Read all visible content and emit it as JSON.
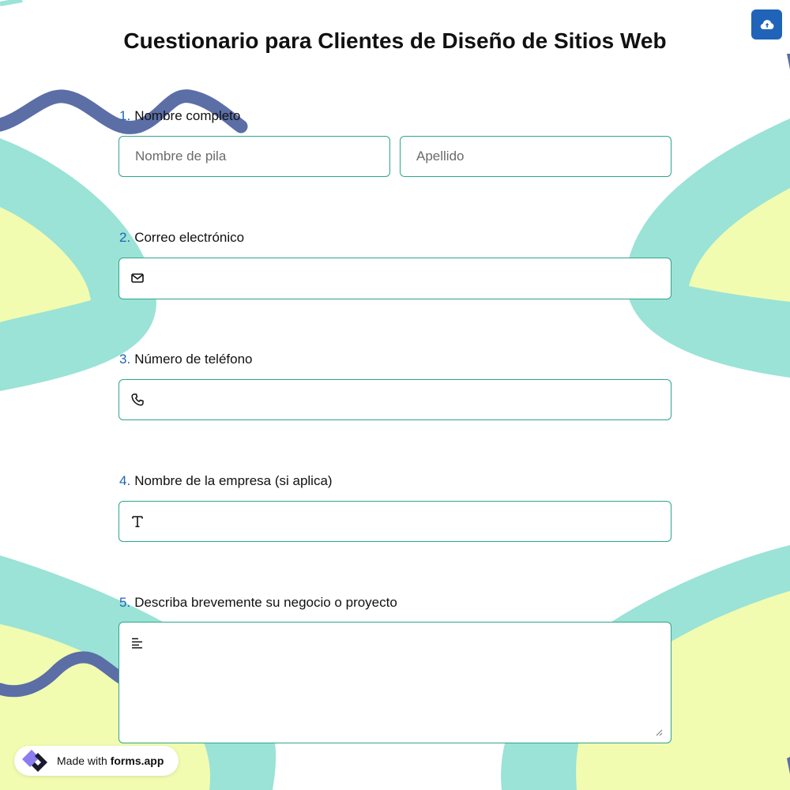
{
  "form": {
    "title": "Cuestionario para Clientes de Diseño de Sitios Web"
  },
  "toolbar": {
    "save_icon": "cloud-upload-icon"
  },
  "questions": [
    {
      "number": "1.",
      "label": "Nombre completo",
      "first_name_placeholder": "Nombre de pila",
      "last_name_placeholder": "Apellido"
    },
    {
      "number": "2.",
      "label": "Correo electrónico",
      "icon": "envelope-icon",
      "value": ""
    },
    {
      "number": "3.",
      "label": "Número de teléfono",
      "icon": "phone-icon",
      "value": ""
    },
    {
      "number": "4.",
      "label": "Nombre de la empresa (si aplica)",
      "icon": "text-icon",
      "value": ""
    },
    {
      "number": "5.",
      "label": "Describa brevemente su negocio o proyecto",
      "icon": "paragraph-icon",
      "value": ""
    }
  ],
  "footer": {
    "made_with": "Made with",
    "brand": "forms.app"
  },
  "colors": {
    "accent": "#1f64b8",
    "field_border": "#2ea68a",
    "teal_shape": "#9ae3d6",
    "yellow_shape": "#f2fcb0",
    "squiggle": "#5b6ea6"
  }
}
